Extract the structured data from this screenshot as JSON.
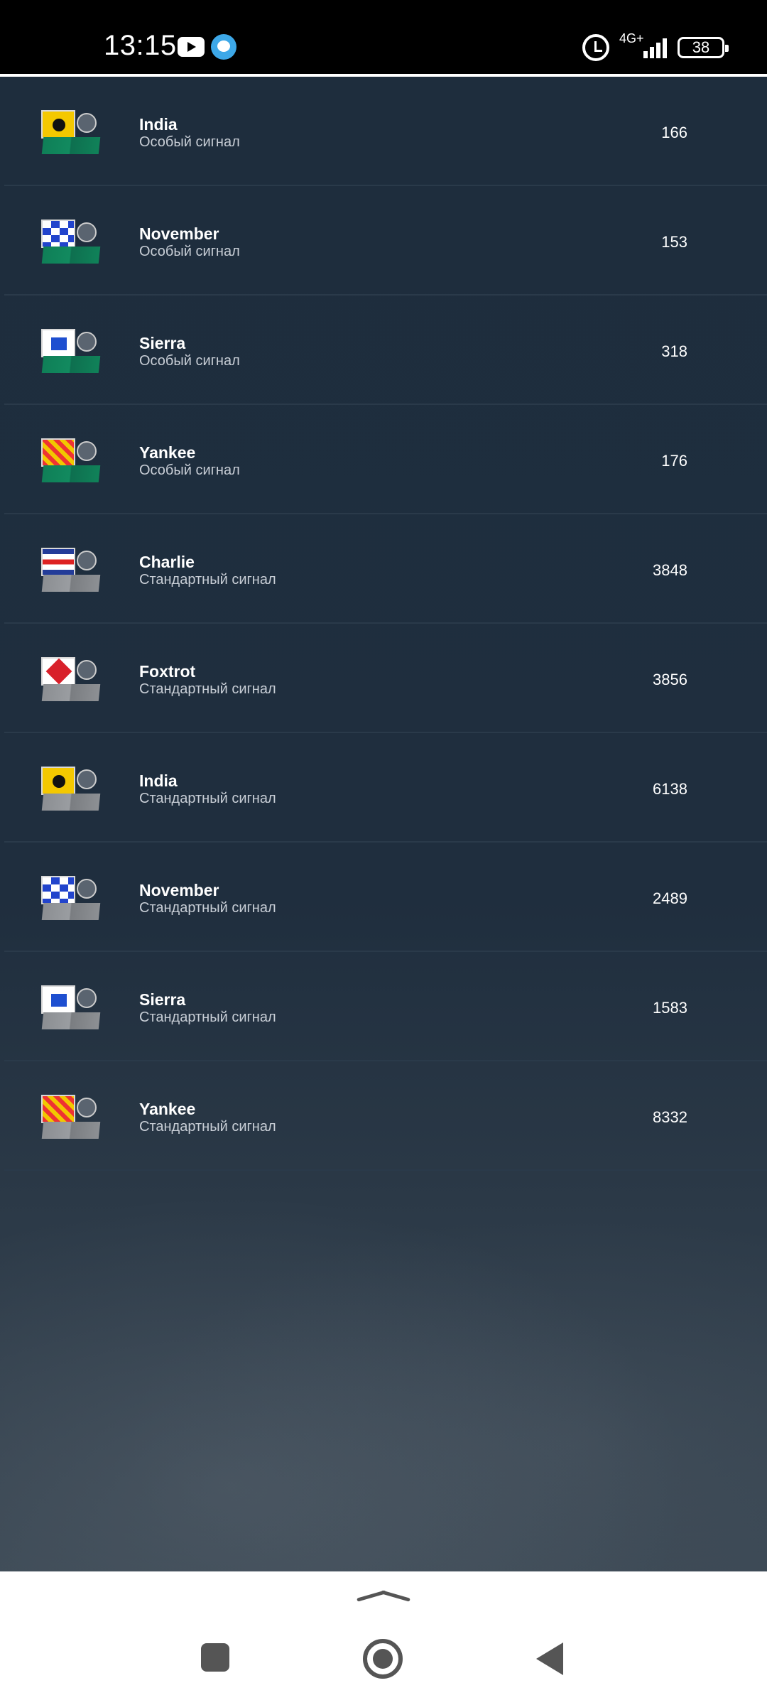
{
  "status_bar": {
    "time": "13:15",
    "network": "4G+",
    "battery": "38",
    "icons": [
      "youtube-icon",
      "messenger-icon",
      "alarm-icon",
      "signal-icon",
      "battery-icon"
    ]
  },
  "list": {
    "items": [
      {
        "title": "India",
        "subtitle": "Особый сигнал",
        "count": "166",
        "flag": "india",
        "emblem": "radar-icon",
        "kind": "special"
      },
      {
        "title": "November",
        "subtitle": "Особый сигнал",
        "count": "153",
        "flag": "november",
        "emblem": "tools-icon",
        "kind": "special"
      },
      {
        "title": "Sierra",
        "subtitle": "Особый сигнал",
        "count": "318",
        "flag": "sierra",
        "emblem": "speedometer-icon",
        "kind": "special"
      },
      {
        "title": "Yankee",
        "subtitle": "Особый сигнал",
        "count": "176",
        "flag": "yankee",
        "emblem": "explosion-icon",
        "kind": "special"
      },
      {
        "title": "Charlie",
        "subtitle": "Стандартный сигнал",
        "count": "3848",
        "flag": "charlie",
        "emblem": "shield-icon",
        "kind": "standard"
      },
      {
        "title": "Foxtrot",
        "subtitle": "Стандартный сигнал",
        "count": "3856",
        "flag": "foxtrot",
        "emblem": "target-icon",
        "kind": "standard"
      },
      {
        "title": "India",
        "subtitle": "Стандартный сигнал",
        "count": "6138",
        "flag": "india",
        "emblem": "radar-icon",
        "kind": "standard"
      },
      {
        "title": "November",
        "subtitle": "Стандартный сигнал",
        "count": "2489",
        "flag": "november",
        "emblem": "tools-icon",
        "kind": "standard"
      },
      {
        "title": "Sierra",
        "subtitle": "Стандартный сигнал",
        "count": "1583",
        "flag": "sierra",
        "emblem": "speedometer-icon",
        "kind": "standard"
      },
      {
        "title": "Yankee",
        "subtitle": "Стандартный сигнал",
        "count": "8332",
        "flag": "yankee",
        "emblem": "explosion-icon",
        "kind": "standard"
      }
    ]
  },
  "colors": {
    "background": "#1e2d3d",
    "divider": "#2a3a4a",
    "special_base": "#0f7f57",
    "standard_base": "#8b8e92"
  }
}
